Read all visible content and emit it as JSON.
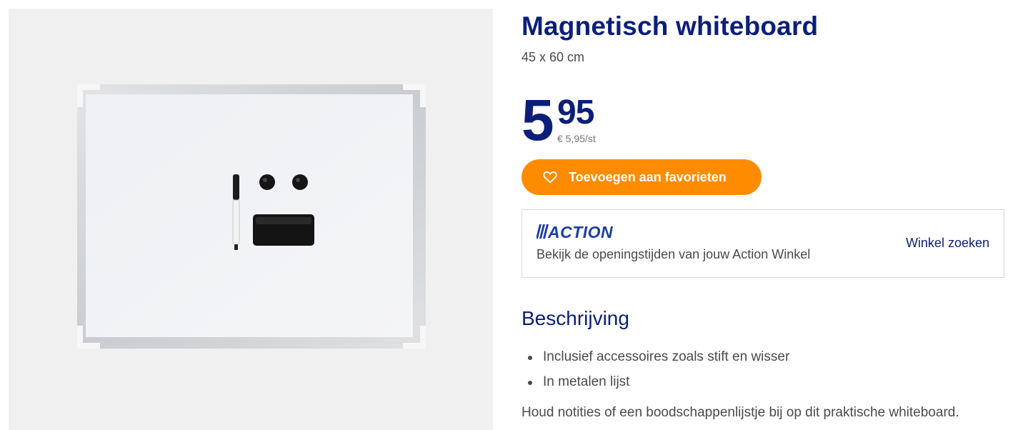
{
  "product": {
    "title": "Magnetisch whiteboard",
    "size": "45 x 60 cm",
    "price_int": "5",
    "price_dec": "95",
    "unit_price": "€ 5,95/st",
    "image_alt": "magnetic-whiteboard-photo"
  },
  "favorite_button": {
    "label": "Toevoegen aan favorieten",
    "icon": "heart-outline-icon"
  },
  "store": {
    "logo_text": "ACTION",
    "text": "Bekijk de openingstijden van jouw Action Winkel",
    "link": "Winkel zoeken"
  },
  "description": {
    "heading": "Beschrijving",
    "features": [
      "Inclusief accessoires zoals stift en wisser",
      "In metalen lijst"
    ],
    "text": "Houd notities of een boodschappenlijstje bij op dit praktische whiteboard."
  },
  "colors": {
    "brand_blue": "#0b1f7a",
    "accent_orange": "#ff8c00",
    "action_logo_blue": "#1b3ea8"
  }
}
